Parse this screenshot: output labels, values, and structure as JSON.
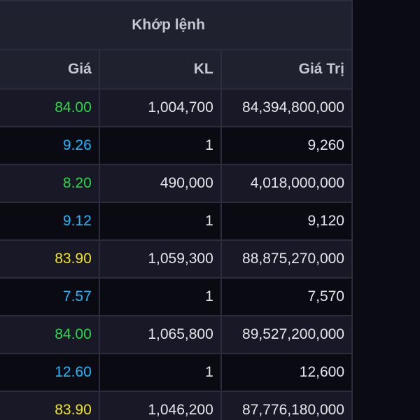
{
  "header": {
    "group_title": "Khớp lệnh",
    "columns": {
      "price": "Giá",
      "volume": "KL",
      "value": "Giá Trị"
    }
  },
  "colors": {
    "green": "#27d94a",
    "cyan": "#1eb8ff",
    "yellow": "#f2e51c"
  },
  "rows": [
    {
      "price": "84.00",
      "price_color": "green",
      "volume": "1,004,700",
      "value": "84,394,800,000"
    },
    {
      "price": "9.26",
      "price_color": "cyan",
      "volume": "1",
      "value": "9,260"
    },
    {
      "price": "8.20",
      "price_color": "green",
      "volume": "490,000",
      "value": "4,018,000,000"
    },
    {
      "price": "9.12",
      "price_color": "cyan",
      "volume": "1",
      "value": "9,120"
    },
    {
      "price": "83.90",
      "price_color": "yellow",
      "volume": "1,059,300",
      "value": "88,875,270,000"
    },
    {
      "price": "7.57",
      "price_color": "cyan",
      "volume": "1",
      "value": "7,570"
    },
    {
      "price": "84.00",
      "price_color": "green",
      "volume": "1,065,800",
      "value": "89,527,200,000"
    },
    {
      "price": "12.60",
      "price_color": "cyan",
      "volume": "1",
      "value": "12,600"
    },
    {
      "price": "83.90",
      "price_color": "yellow",
      "volume": "1,046,200",
      "value": "87,776,180,000"
    }
  ]
}
